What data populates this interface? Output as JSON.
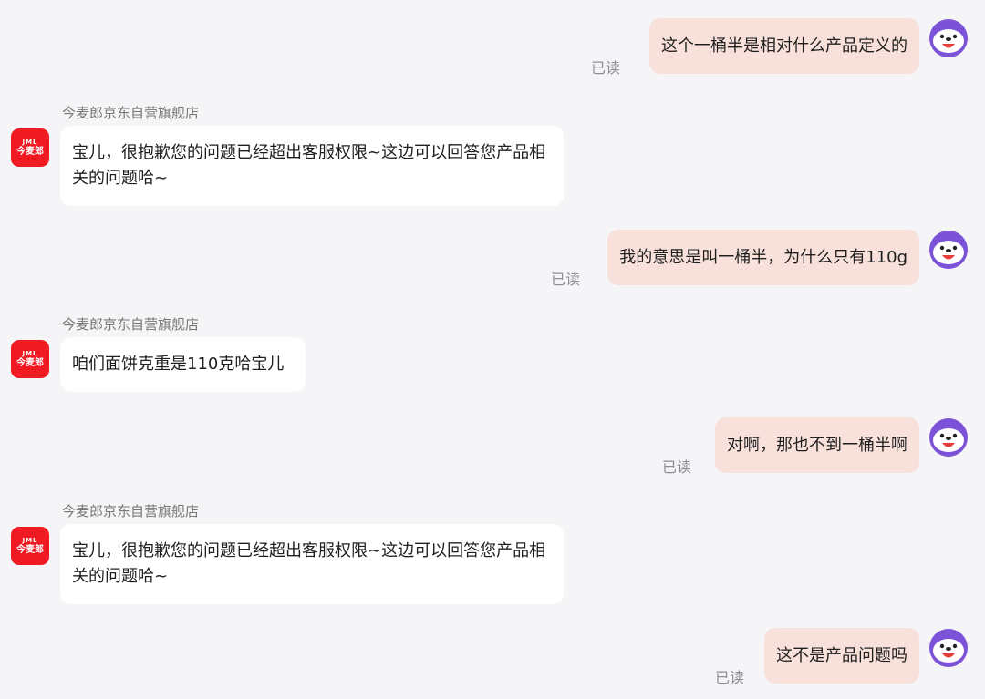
{
  "messages": [
    {
      "side": "out",
      "text": "这个一桶半是相对什么产品定义的",
      "status": "已读"
    },
    {
      "side": "in",
      "sender": "今麦郎京东自营旗舰店",
      "text": "宝儿，很抱歉您的问题已经超出客服权限~这边可以回答您产品相关的问题哈~"
    },
    {
      "side": "out",
      "text": "我的意思是叫一桶半，为什么只有110g",
      "status": "已读"
    },
    {
      "side": "in",
      "sender": "今麦郎京东自营旗舰店",
      "text": "咱们面饼克重是110克哈宝儿"
    },
    {
      "side": "out",
      "text": "对啊，那也不到一桶半啊",
      "status": "已读"
    },
    {
      "side": "in",
      "sender": "今麦郎京东自营旗舰店",
      "text": "宝儿，很抱歉您的问题已经超出客服权限~这边可以回答您产品相关的问题哈~"
    },
    {
      "side": "out",
      "text": "这不是产品问题吗",
      "status": "已读"
    }
  ],
  "shop_logo": {
    "line1": "JML",
    "line2": "今麦郎"
  },
  "colors": {
    "out_bubble": "#f9e1db",
    "in_bubble": "#ffffff",
    "logo_bg": "#f01a22",
    "avatar": "#7b52d8"
  }
}
